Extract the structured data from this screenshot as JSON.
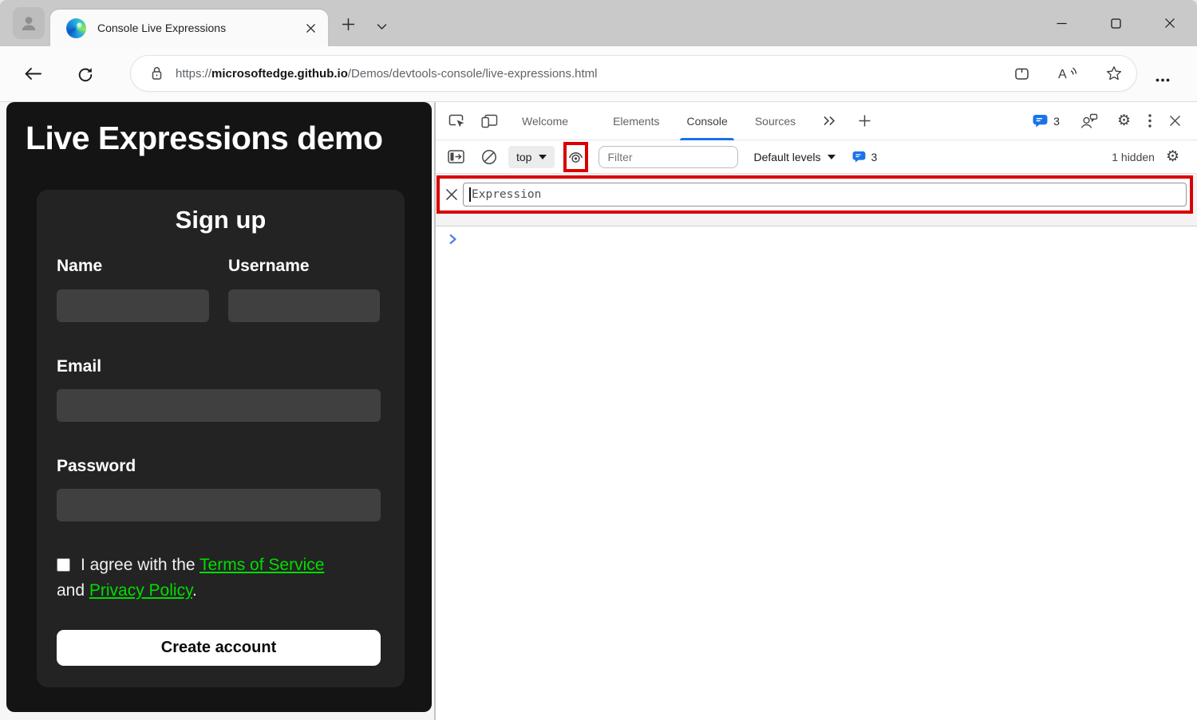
{
  "window": {
    "tab_title": "Console Live Expressions"
  },
  "browser": {
    "url_scheme": "https://",
    "url_host": "microsoftedge.github.io",
    "url_path": "/Demos/devtools-console/live-expressions.html"
  },
  "page": {
    "title": "Live Expressions demo",
    "form": {
      "heading": "Sign up",
      "name_label": "Name",
      "username_label": "Username",
      "email_label": "Email",
      "password_label": "Password",
      "agree_prefix": "I agree with the ",
      "terms_link": "Terms of Service",
      "agree_middle": "and ",
      "privacy_link": "Privacy Policy",
      "agree_suffix": ".",
      "submit_label": "Create account"
    }
  },
  "devtools": {
    "tabs": [
      {
        "label": "Welcome"
      },
      {
        "label": "Elements"
      },
      {
        "label": "Console"
      },
      {
        "label": "Sources"
      }
    ],
    "active_tab": "Console",
    "issues_count": "3",
    "toolbar": {
      "context_label": "top",
      "filter_placeholder": "Filter",
      "levels_label": "Default levels",
      "hidden_label": "1 hidden"
    },
    "live_expression": {
      "placeholder": "Expression"
    }
  },
  "icons": {
    "gear": "⚙"
  },
  "colors": {
    "accent_blue": "#1a73e8",
    "highlight_red": "#d90000",
    "link_green": "#00dd00",
    "badge_blue": "#1a73e8",
    "page_background": "#141414",
    "card_background": "#232323"
  }
}
